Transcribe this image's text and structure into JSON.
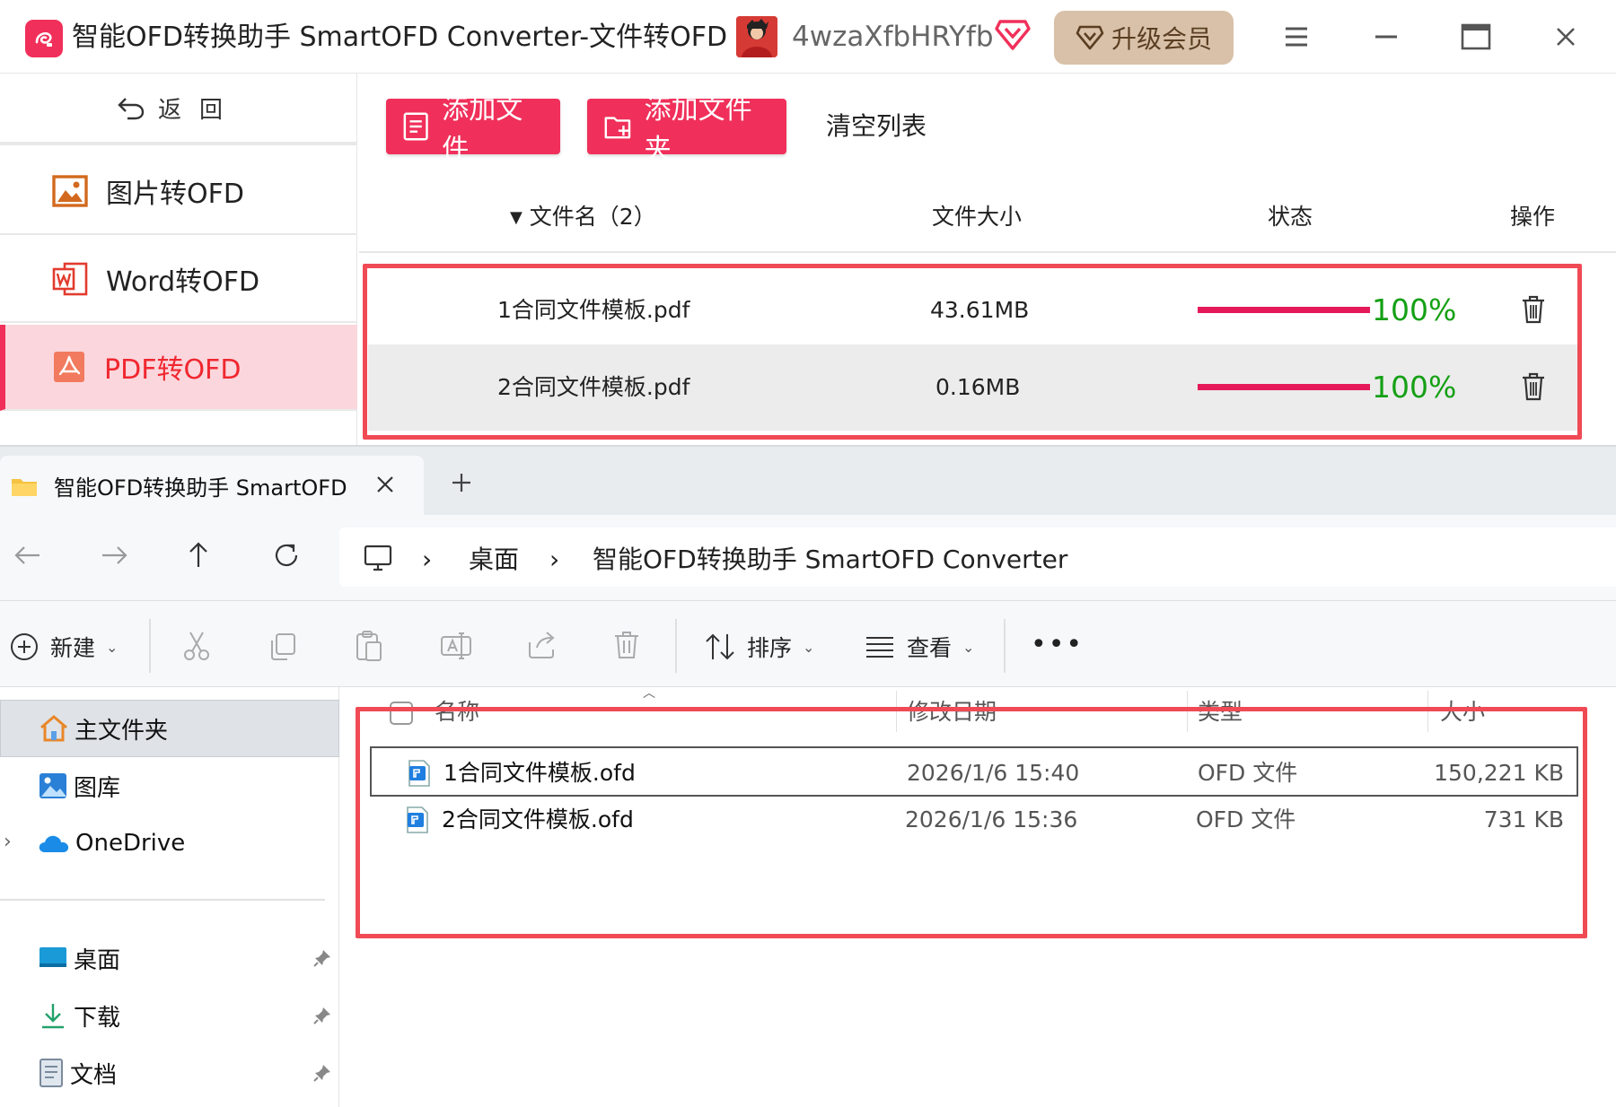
{
  "app": {
    "title": "智能OFD转换助手 SmartOFD Converter-文件转OFD",
    "username": "4wzaXfbHRYfb",
    "upgrade_label": "升级会员",
    "accent": "#f0305a"
  },
  "sidebar": {
    "back_label": "返回",
    "items": [
      {
        "label": "图片转OFD",
        "icon": "image-icon"
      },
      {
        "label": "Word转OFD",
        "icon": "word-icon"
      },
      {
        "label": "PDF转OFD",
        "icon": "pdf-icon",
        "active": true
      }
    ]
  },
  "toolbar": {
    "add_file": "添加文件",
    "add_folder": "添加文件夹",
    "clear_list": "清空列表"
  },
  "file_table": {
    "headers": {
      "name": "文件名（2）",
      "size": "文件大小",
      "status": "状态",
      "action": "操作"
    },
    "rows": [
      {
        "name": "1合同文件模板.pdf",
        "size": "43.61MB",
        "progress": 1.0,
        "percent": "100%"
      },
      {
        "name": "2合同文件模板.pdf",
        "size": "0.16MB",
        "progress": 1.0,
        "percent": "100%"
      }
    ]
  },
  "explorer": {
    "tab_title": "智能OFD转换助手 SmartOFD Converter",
    "breadcrumb": [
      "桌面",
      "智能OFD转换助手 SmartOFD Converter"
    ],
    "commands": {
      "new": "新建",
      "sort": "排序",
      "view": "查看"
    },
    "nav": [
      {
        "label": "主文件夹",
        "icon": "home-icon"
      },
      {
        "label": "图库",
        "icon": "gallery-icon"
      },
      {
        "label": "OneDrive",
        "icon": "onedrive-icon"
      },
      {
        "label": "桌面",
        "icon": "desktop-icon"
      },
      {
        "label": "下载",
        "icon": "download-icon"
      },
      {
        "label": "文档",
        "icon": "document-icon"
      }
    ],
    "columns": {
      "name": "名称",
      "modified": "修改日期",
      "type": "类型",
      "size": "大小"
    },
    "files": [
      {
        "name": "1合同文件模板.ofd",
        "modified": "2026/1/6 15:40",
        "type": "OFD 文件",
        "size": "150,221 KB"
      },
      {
        "name": "2合同文件模板.ofd",
        "modified": "2026/1/6 15:36",
        "type": "OFD 文件",
        "size": "731 KB"
      }
    ]
  }
}
